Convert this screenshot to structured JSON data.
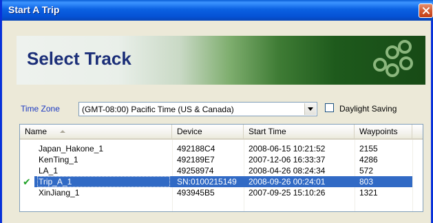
{
  "window": {
    "title": "Start A Trip"
  },
  "banner": {
    "title": "Select Track",
    "logo_icon": "circles-logo-icon"
  },
  "timezone": {
    "label": "Time Zone",
    "selected": "(GMT-08:00) Pacific Time (US & Canada)"
  },
  "daylight_saving": {
    "label": "Daylight Saving",
    "checked": false
  },
  "table": {
    "columns": [
      "Name",
      "Device",
      "Start Time",
      "Waypoints"
    ],
    "sort_column": "Name",
    "sort_direction": "ascending",
    "rows": [
      {
        "name": "Japan_Hakone_1",
        "device": "492188C4",
        "start": "2008-06-15 10:21:52",
        "waypoints": "2155",
        "selected": false,
        "checked": false
      },
      {
        "name": "KenTing_1",
        "device": "492189E7",
        "start": "2007-12-06 16:33:37",
        "waypoints": "4286",
        "selected": false,
        "checked": false
      },
      {
        "name": "LA_1",
        "device": "49258974",
        "start": "2008-04-26 08:24:34",
        "waypoints": "572",
        "selected": false,
        "checked": false
      },
      {
        "name": "Trip_A_1",
        "device": "SN:0100215149",
        "start": "2008-09-26 00:24:01",
        "waypoints": "803",
        "selected": true,
        "checked": true
      },
      {
        "name": "XinJiang_1",
        "device": "493945B5",
        "start": "2007-09-25 15:10:26",
        "waypoints": "1321",
        "selected": false,
        "checked": false
      }
    ]
  },
  "colors": {
    "titlebar": "#0b61e2",
    "selection": "#316ac5",
    "banner_title": "#1b2e78",
    "check": "#22a32a"
  }
}
